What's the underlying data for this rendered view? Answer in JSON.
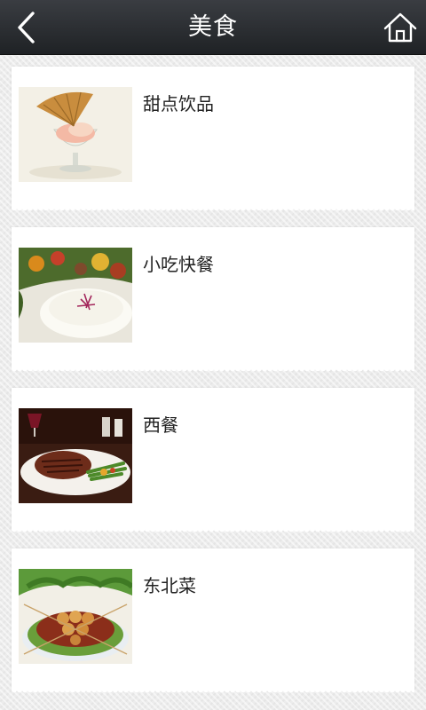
{
  "header": {
    "title": "美食",
    "back_icon": "chevron-left-icon",
    "home_icon": "home-icon"
  },
  "categories": [
    {
      "label": "甜点饮品",
      "image": "dessert-photo"
    },
    {
      "label": "小吃快餐",
      "image": "rice-plate-photo"
    },
    {
      "label": "西餐",
      "image": "steak-plate-photo"
    },
    {
      "label": "东北菜",
      "image": "skewers-photo"
    }
  ],
  "colors": {
    "header_bg": "#2a2d31",
    "card_bg": "#ffffff",
    "page_bg": "#ececec",
    "text": "#222222"
  }
}
